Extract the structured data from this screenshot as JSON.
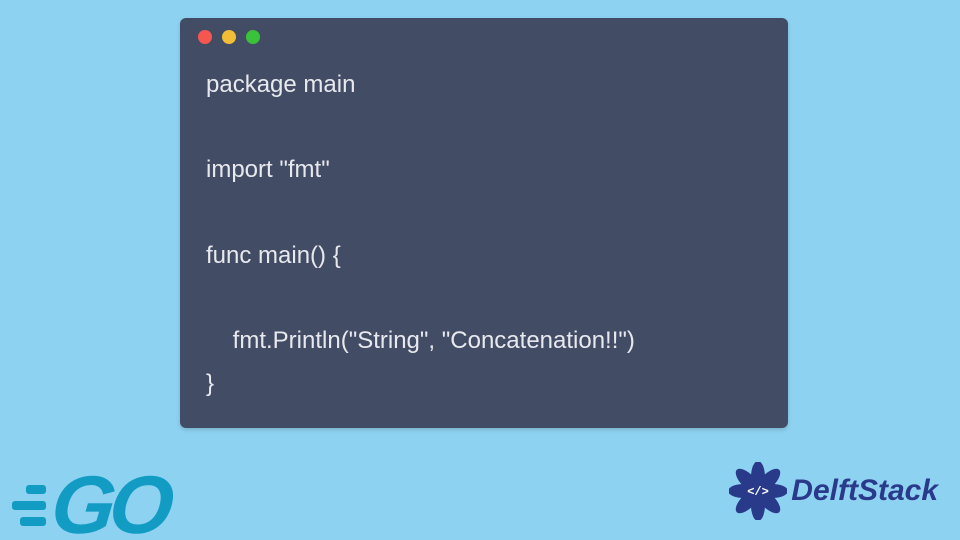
{
  "code": {
    "lines": [
      "package main",
      "",
      "import \"fmt\"",
      "",
      "func main() {",
      "",
      "    fmt.Println(\"String\", \"Concatenation!!\")",
      "}"
    ]
  },
  "logos": {
    "go": "GO",
    "delftstack": "DelftStack"
  },
  "window": {
    "dots": [
      "red",
      "yellow",
      "green"
    ]
  },
  "colors": {
    "bg": "#8ed2f2",
    "window": "#424c65",
    "go": "#129cc4",
    "delft": "#2a3a8a"
  }
}
